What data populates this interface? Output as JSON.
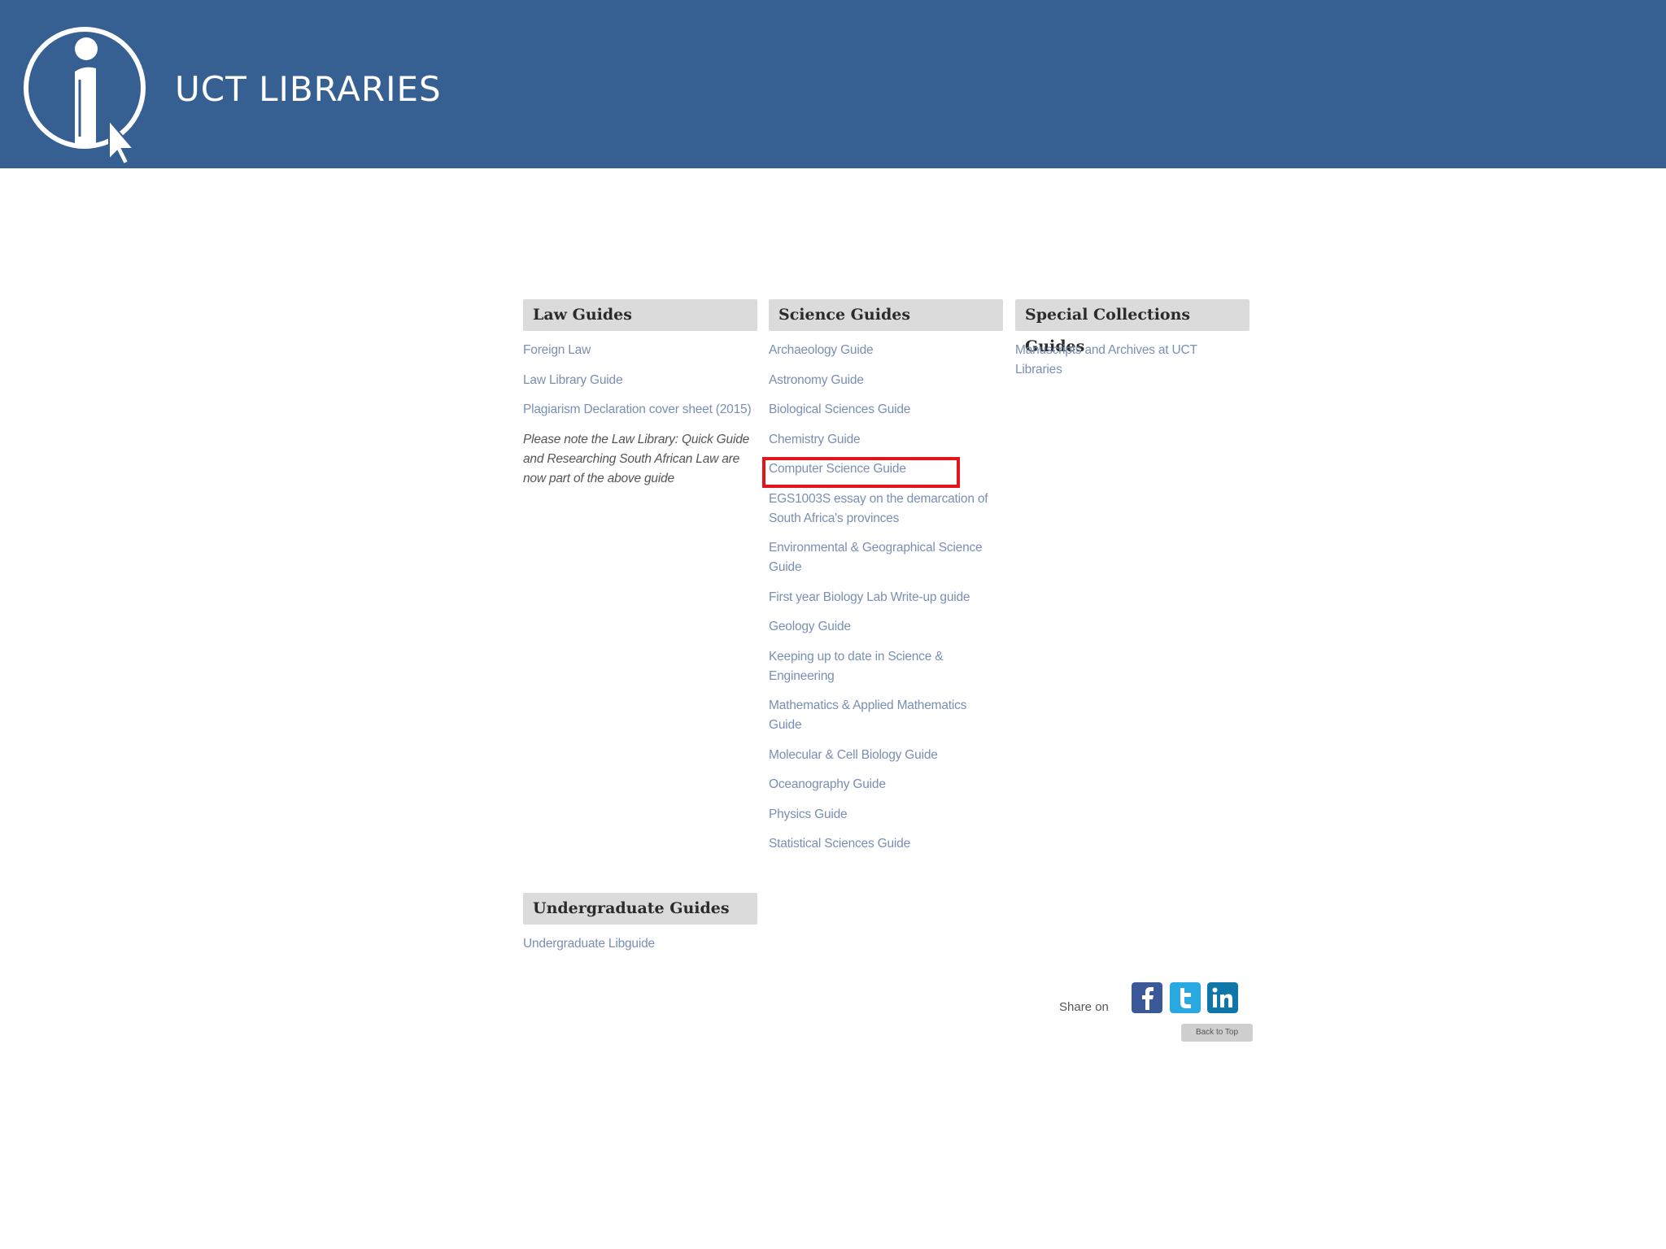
{
  "banner": {
    "title": "UCT LIBRARIES"
  },
  "law": {
    "header": "Law Guides",
    "links": [
      "Foreign Law",
      "Law Library Guide",
      "Plagiarism Declaration cover sheet (2015)"
    ],
    "note": "Please note the Law Library: Quick Guide and Researching South African Law are now part of the above guide"
  },
  "science": {
    "header": "Science Guides",
    "links": [
      "Archaeology Guide",
      "Astronomy Guide",
      "Biological Sciences Guide",
      "Chemistry Guide",
      "Computer Science Guide",
      "EGS1003S essay on the demarcation of South Africa's provinces",
      "Environmental & Geographical Science Guide",
      "First year Biology Lab Write-up guide",
      "Geology Guide",
      "Keeping up to date in Science & Engineering",
      "Mathematics & Applied Mathematics Guide",
      "Molecular & Cell Biology Guide",
      "Oceanography Guide",
      "Physics Guide",
      "Statistical Sciences Guide"
    ]
  },
  "special": {
    "header": "Special Collections Guides",
    "links": [
      "Manuscripts and Archives at UCT Libraries"
    ]
  },
  "undergrad": {
    "header": "Undergraduate Guides",
    "links": [
      "Undergraduate Libguide"
    ]
  },
  "share": {
    "label": "Share on",
    "back_to_top": "Back to Top",
    "colors": {
      "facebook": "#3b5998",
      "twitter": "#29a9e1",
      "linkedin": "#0e76a8"
    }
  },
  "highlight": {
    "color": "#e3141b",
    "target": "Computer Science Guide"
  }
}
